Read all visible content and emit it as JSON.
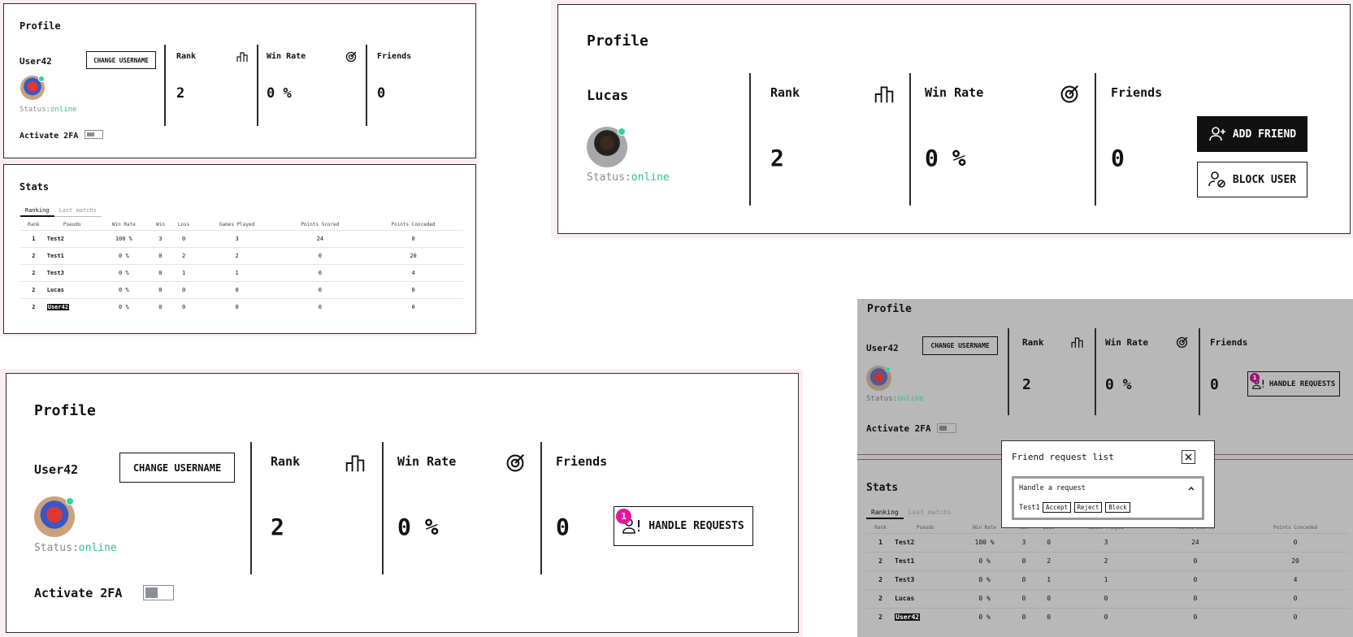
{
  "profile": {
    "title": "Profile",
    "username": "User42",
    "change_username_label": "CHANGE USERNAME",
    "status_prefix": "Status:",
    "status_value": "online",
    "activate_2fa_label": "Activate 2FA",
    "rank_label": "Rank",
    "rank_value": "2",
    "win_rate_label": "Win Rate",
    "win_rate_value": "0 %",
    "friends_label": "Friends",
    "friends_value": "0",
    "handle_requests_label": "HANDLE REQUESTS",
    "requests_badge": "1"
  },
  "other_profile": {
    "title": "Profile",
    "username": "Lucas",
    "status_prefix": "Status:",
    "status_value": "online",
    "rank_label": "Rank",
    "rank_value": "2",
    "win_rate_label": "Win Rate",
    "win_rate_value": "0 %",
    "friends_label": "Friends",
    "friends_value": "0",
    "add_friend_label": "ADD FRIEND",
    "block_user_label": "BLOCK USER"
  },
  "stats": {
    "title": "Stats",
    "tabs": [
      "Ranking",
      "Last matchs"
    ],
    "columns": [
      "Rank",
      "Pseudo",
      "Win Rate",
      "Win",
      "Loss",
      "Games Played",
      "Points Scored",
      "Points Conceded"
    ],
    "rows": [
      [
        "1",
        "Test2",
        "100 %",
        "3",
        "0",
        "3",
        "24",
        "0"
      ],
      [
        "2",
        "Test1",
        "0 %",
        "0",
        "2",
        "2",
        "0",
        "20"
      ],
      [
        "2",
        "Test3",
        "0 %",
        "0",
        "1",
        "1",
        "0",
        "4"
      ],
      [
        "2",
        "Lucas",
        "0 %",
        "0",
        "0",
        "0",
        "0",
        "0"
      ],
      [
        "2",
        "User42",
        "0 %",
        "0",
        "0",
        "0",
        "0",
        "0"
      ]
    ]
  },
  "friend_modal": {
    "title": "Friend request list",
    "section_label": "Handle a request",
    "requester": "Test1",
    "accept_label": "Accept",
    "reject_label": "Reject",
    "block_label": "Block"
  },
  "colors": {
    "online": "#2fbf8a",
    "badge": "#e5159b",
    "overlay": "#b8b8b8",
    "frame_tint": "#fbeef3"
  },
  "icons": [
    "podium-icon",
    "target-icon",
    "user-plus-icon",
    "user-block-icon",
    "user-alert-icon",
    "close-icon",
    "chevron-up-icon"
  ]
}
